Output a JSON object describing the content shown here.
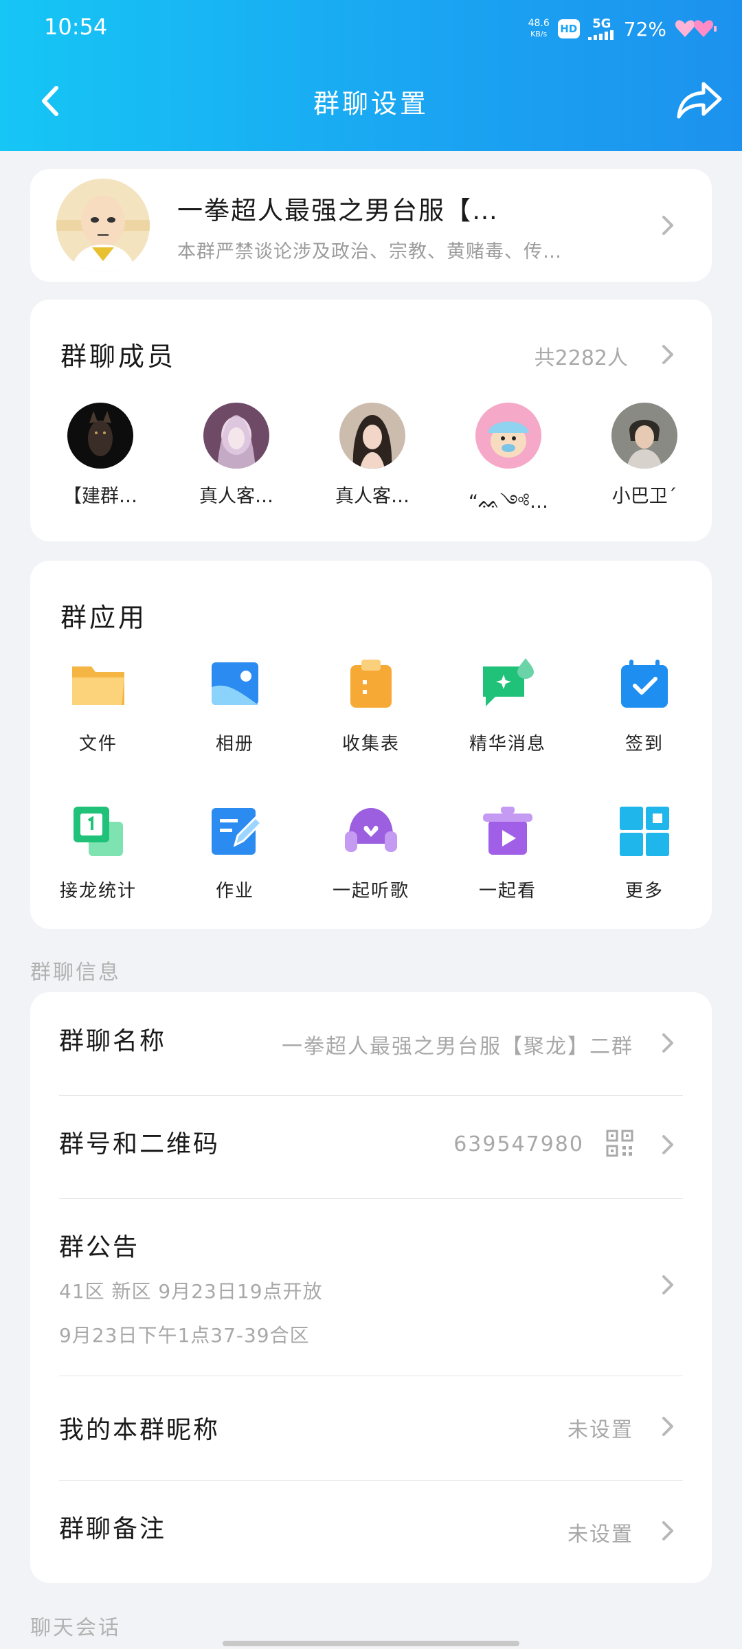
{
  "status_bar": {
    "time": "10:54",
    "net_speed": "48.6",
    "net_unit": "KB/s",
    "hd": "HD",
    "network": "5G",
    "battery": "72%"
  },
  "nav": {
    "title": "群聊设置"
  },
  "group": {
    "name": "一拳超人最强之男台服【…",
    "description": "本群严禁谈论涉及政治、宗教、黄赌毒、传…"
  },
  "members": {
    "title": "群聊成员",
    "count": "共2282人",
    "list": [
      {
        "name": "【建群…"
      },
      {
        "name": "真人客…"
      },
      {
        "name": "真人客…"
      },
      {
        "name": "“ᨐ༺…"
      },
      {
        "name": "小巴卫´"
      }
    ]
  },
  "apps": {
    "title": "群应用",
    "items": [
      {
        "label": "文件",
        "icon": "folder-icon"
      },
      {
        "label": "相册",
        "icon": "album-icon"
      },
      {
        "label": "收集表",
        "icon": "clipboard-icon"
      },
      {
        "label": "精华消息",
        "icon": "essence-message-icon"
      },
      {
        "label": "签到",
        "icon": "calendar-check-icon"
      },
      {
        "label": "接龙统计",
        "icon": "relay-stats-icon"
      },
      {
        "label": "作业",
        "icon": "homework-icon"
      },
      {
        "label": "一起听歌",
        "icon": "headphones-icon"
      },
      {
        "label": "一起看",
        "icon": "watch-together-icon"
      },
      {
        "label": "更多",
        "icon": "grid-more-icon"
      }
    ]
  },
  "info": {
    "section_label": "群聊信息",
    "group_name_label": "群聊名称",
    "group_name_value": "一拳超人最强之男台服【聚龙】二群",
    "group_id_label": "群号和二维码",
    "group_id_value": "639547980",
    "notice_label": "群公告",
    "notice_line1": "41区 新区 9月23日19点开放",
    "notice_line2": "9月23日下午1点37-39合区",
    "nickname_label": "我的本群昵称",
    "nickname_value": "未设置",
    "remark_label": "群聊备注",
    "remark_value": "未设置"
  },
  "chat_section_label": "聊天会话",
  "colors": {
    "header_start": "#16c6f5",
    "header_end": "#1c92ee",
    "background": "#f2f3f7"
  }
}
